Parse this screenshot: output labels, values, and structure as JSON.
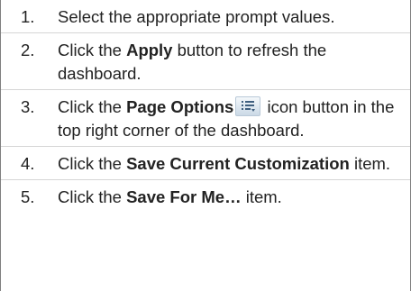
{
  "steps": [
    {
      "number": "1.",
      "parts": [
        {
          "text": "Select the appropriate prompt values.",
          "bold": false
        }
      ]
    },
    {
      "number": "2.",
      "parts": [
        {
          "text": "Click the ",
          "bold": false
        },
        {
          "text": "Apply",
          "bold": true
        },
        {
          "text": " button to refresh the dashboard.",
          "bold": false
        }
      ]
    },
    {
      "number": "3.",
      "parts": [
        {
          "text": "Click the ",
          "bold": false
        },
        {
          "text": "Page Options",
          "bold": true
        },
        {
          "icon": "page-options-icon"
        },
        {
          "text": " icon button in the top right corner of the dashboard.",
          "bold": false
        }
      ]
    },
    {
      "number": "4.",
      "parts": [
        {
          "text": "Click the ",
          "bold": false
        },
        {
          "text": "Save Current Customization",
          "bold": true
        },
        {
          "text": " item.",
          "bold": false
        }
      ]
    },
    {
      "number": "5.",
      "parts": [
        {
          "text": "Click the ",
          "bold": false
        },
        {
          "text": "Save For Me…",
          "bold": true
        },
        {
          "text": " item.",
          "bold": false
        }
      ]
    }
  ],
  "colors": {
    "text": "#222222",
    "divider": "#d5d5d5",
    "frame_border": "#7f7f7f",
    "icon_line": "#3f5f7f"
  }
}
